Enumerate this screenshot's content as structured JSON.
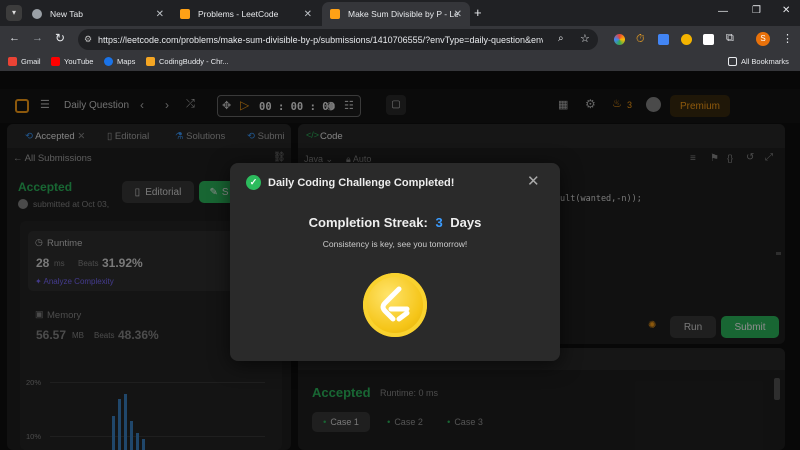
{
  "browser": {
    "tabs": [
      {
        "title": "New Tab"
      },
      {
        "title": "Problems - LeetCode"
      },
      {
        "title": "Make Sum Divisible by P - LeetC"
      }
    ],
    "url": "https://leetcode.com/problems/make-sum-divisible-by-p/submissions/1410706555/?envType=daily-question&envI...",
    "bookmarks": [
      "Gmail",
      "YouTube",
      "Maps",
      "CodingBuddy - Chr..."
    ],
    "all_bookmarks": "All Bookmarks",
    "profile_initial": "S"
  },
  "nav": {
    "daily_question": "Daily Question",
    "timer": "00 : 00 : 00",
    "streak_count": "3",
    "premium": "Premium"
  },
  "left_tabs": {
    "accepted": "Accepted",
    "editorial": "Editorial",
    "solutions": "Solutions",
    "submissions": "Submi"
  },
  "submission": {
    "back": "All Submissions",
    "status": "Accepted",
    "submitted_at": "submitted at Oct 03,",
    "editorial_btn": "Editorial",
    "solution_btn": "S",
    "runtime_label": "Runtime",
    "runtime_value": "28",
    "runtime_unit": "ms",
    "beats_label": "Beats",
    "runtime_beats": "31.92%",
    "analyze": "Analyze Complexity",
    "memory_label": "Memory",
    "memory_value": "56.57",
    "memory_unit": "MB",
    "memory_beats": "48.36%",
    "axis_top": "20%",
    "axis_mid": "10%"
  },
  "code_panel": {
    "title": "Code",
    "language": "Java",
    "auto": "Auto",
    "code_fragment": "ult(wanted,-n));",
    "run": "Run",
    "submit": "Submit"
  },
  "result_panel": {
    "status": "Accepted",
    "runtime": "Runtime: 0 ms",
    "cases": [
      "Case 1",
      "Case 2",
      "Case 3"
    ]
  },
  "modal": {
    "title": "Daily Coding Challenge Completed!",
    "streak_label": "Completion Streak:",
    "streak_number": "3",
    "streak_unit": "Days",
    "message": "Consistency is key, see you tomorrow!"
  },
  "colors": {
    "accent_green": "#2cbb5d",
    "accent_blue": "#3b9cff",
    "coin_gold": "#f5c518",
    "premium": "#ffa116"
  }
}
